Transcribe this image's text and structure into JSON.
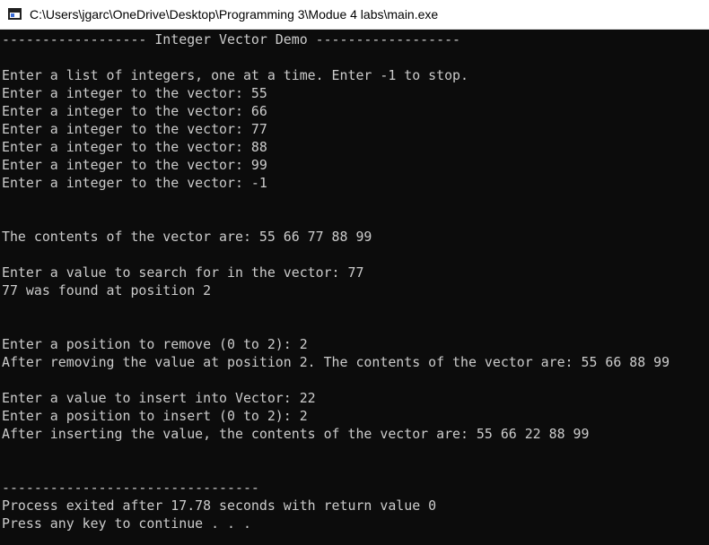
{
  "window": {
    "title": "C:\\Users\\jgarc\\OneDrive\\Desktop\\Programming 3\\Modue 4 labs\\main.exe"
  },
  "console": {
    "lines": [
      "------------------ Integer Vector Demo ------------------",
      "",
      "Enter a list of integers, one at a time. Enter -1 to stop.",
      "Enter a integer to the vector: 55",
      "Enter a integer to the vector: 66",
      "Enter a integer to the vector: 77",
      "Enter a integer to the vector: 88",
      "Enter a integer to the vector: 99",
      "Enter a integer to the vector: -1",
      "",
      "",
      "The contents of the vector are: 55 66 77 88 99",
      "",
      "Enter a value to search for in the vector: 77",
      "77 was found at position 2",
      "",
      "",
      "Enter a position to remove (0 to 2): 2",
      "After removing the value at position 2. The contents of the vector are: 55 66 88 99",
      "",
      "Enter a value to insert into Vector: 22",
      "Enter a position to insert (0 to 2): 2",
      "After inserting the value, the contents of the vector are: 55 66 22 88 99",
      "",
      "",
      "--------------------------------",
      "Process exited after 17.78 seconds with return value 0",
      "Press any key to continue . . ."
    ]
  }
}
